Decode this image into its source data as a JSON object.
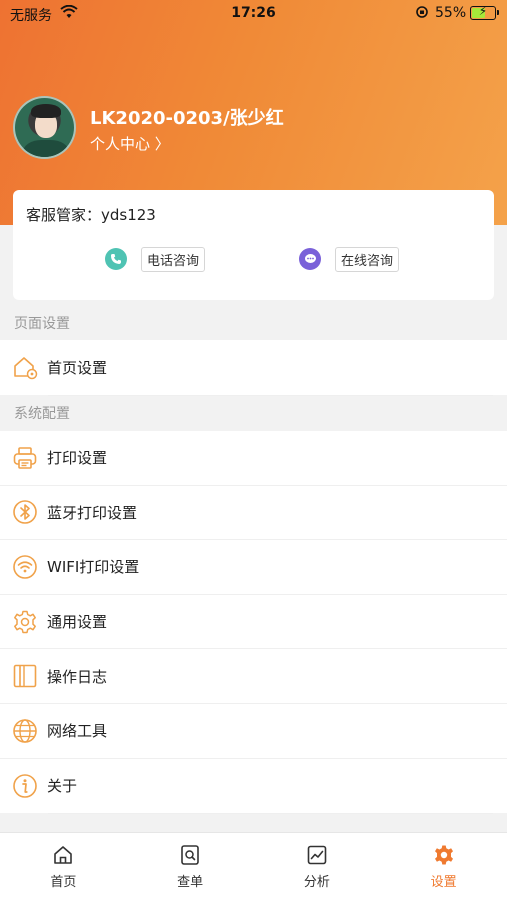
{
  "status_bar": {
    "carrier": "无服务",
    "time": "17:26",
    "battery_percent": "55%",
    "battery_level": 0.55
  },
  "profile": {
    "name": "LK2020-0203/张少红",
    "personal_center": "个人中心 〉"
  },
  "service": {
    "manager": "客服管家：yds123",
    "phone_label": "电话咨询",
    "online_label": "在线咨询"
  },
  "sections": {
    "page_settings": "页面设置",
    "system_config": "系统配置"
  },
  "page_settings_items": [
    {
      "label": "首页设置",
      "icon": "home-settings-icon"
    }
  ],
  "system_items": [
    {
      "label": "打印设置",
      "icon": "printer-icon"
    },
    {
      "label": "蓝牙打印设置",
      "icon": "bluetooth-icon"
    },
    {
      "label": "WIFI打印设置",
      "icon": "wifi-icon"
    },
    {
      "label": "通用设置",
      "icon": "gear-icon"
    },
    {
      "label": "操作日志",
      "icon": "log-book-icon"
    },
    {
      "label": "网络工具",
      "icon": "globe-icon"
    },
    {
      "label": "关于",
      "icon": "info-icon"
    }
  ],
  "tabs": [
    {
      "label": "首页",
      "icon": "home-icon",
      "active": false
    },
    {
      "label": "查单",
      "icon": "search-order-icon",
      "active": false
    },
    {
      "label": "分析",
      "icon": "chart-icon",
      "active": false
    },
    {
      "label": "设置",
      "icon": "settings-gear-icon",
      "active": true
    }
  ],
  "colors": {
    "accent": "#ef7a30",
    "icon_orange": "#f0a24a",
    "phone_teal": "#4fc3b3",
    "online_purple": "#7a61d9"
  }
}
